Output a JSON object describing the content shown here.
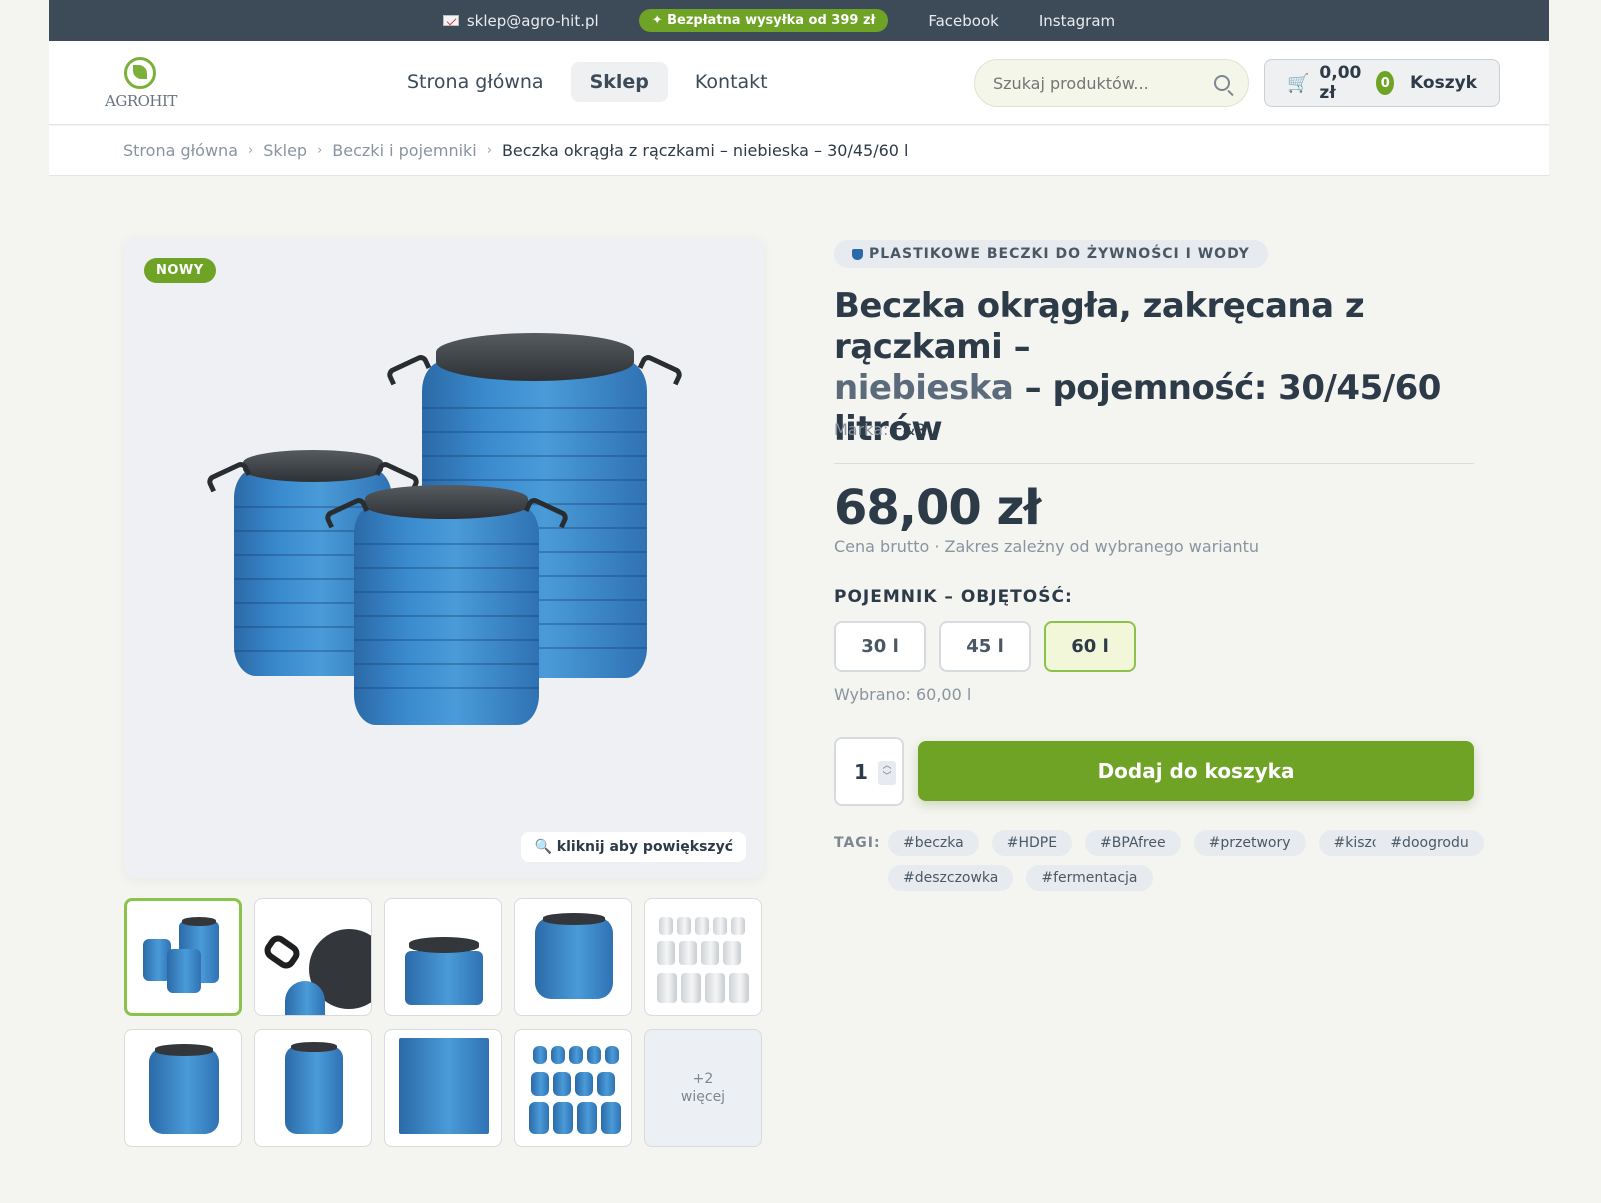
{
  "topbar": {
    "email": "sklep@agro-hit.pl",
    "shipping_badge": "✦ Bezpłatna wysyłka od 399 zł",
    "social": [
      "Facebook",
      "Instagram"
    ]
  },
  "header": {
    "logo_text": "AGROHIT",
    "nav": [
      "Strona główna",
      "Sklep",
      "Kontakt"
    ],
    "active_nav": "Sklep",
    "search_placeholder": "Szukaj produktów...",
    "cart_total": "0,00 zł",
    "cart_count": "0",
    "cart_label": "Koszyk"
  },
  "breadcrumb": [
    "Strona główna",
    "Sklep",
    "Beczki i pojemniki",
    "Beczka okrągła z rączkami – niebieska – 30/45/60 l"
  ],
  "gallery": {
    "badge": "NOWY",
    "zoom_hint": "🔍 kliknij aby powiększyć",
    "more_label_1": "+2",
    "more_label_2": "więcej"
  },
  "product": {
    "category": "PLASTIKOWE BECZKI DO ŻYWNOŚCI I WODY",
    "title_part1": "Beczka okrągła, zakręcana z rączkami –",
    "title_accent": "niebieska",
    "title_part2": "– pojemność: 30/45/60 litrów",
    "brand_label": "Marka:",
    "brand": "F&R",
    "price": "68,00 zł",
    "price_note": "Cena brutto · Zakres zależny od wybranego wariantu",
    "variant_label": "POJEMNIK – OBJĘTOŚĆ:",
    "variants": [
      "30 l",
      "45 l",
      "60 l"
    ],
    "selected_variant": "60 l",
    "selected_note": "Wybrano: 60,00 l",
    "quantity": "1",
    "add_to_cart": "Dodaj do koszyka",
    "tags_label": "TAGI:",
    "tags": [
      "#beczka",
      "#HDPE",
      "#BPAfree",
      "#przetwory",
      "#kiszonki",
      "#doogrodu",
      "#deszczowka",
      "#fermentacja"
    ]
  },
  "colors": {
    "accent_green": "#6fa325",
    "dark_slate": "#3d4a58",
    "barrel_blue": "#3b8ccf"
  }
}
